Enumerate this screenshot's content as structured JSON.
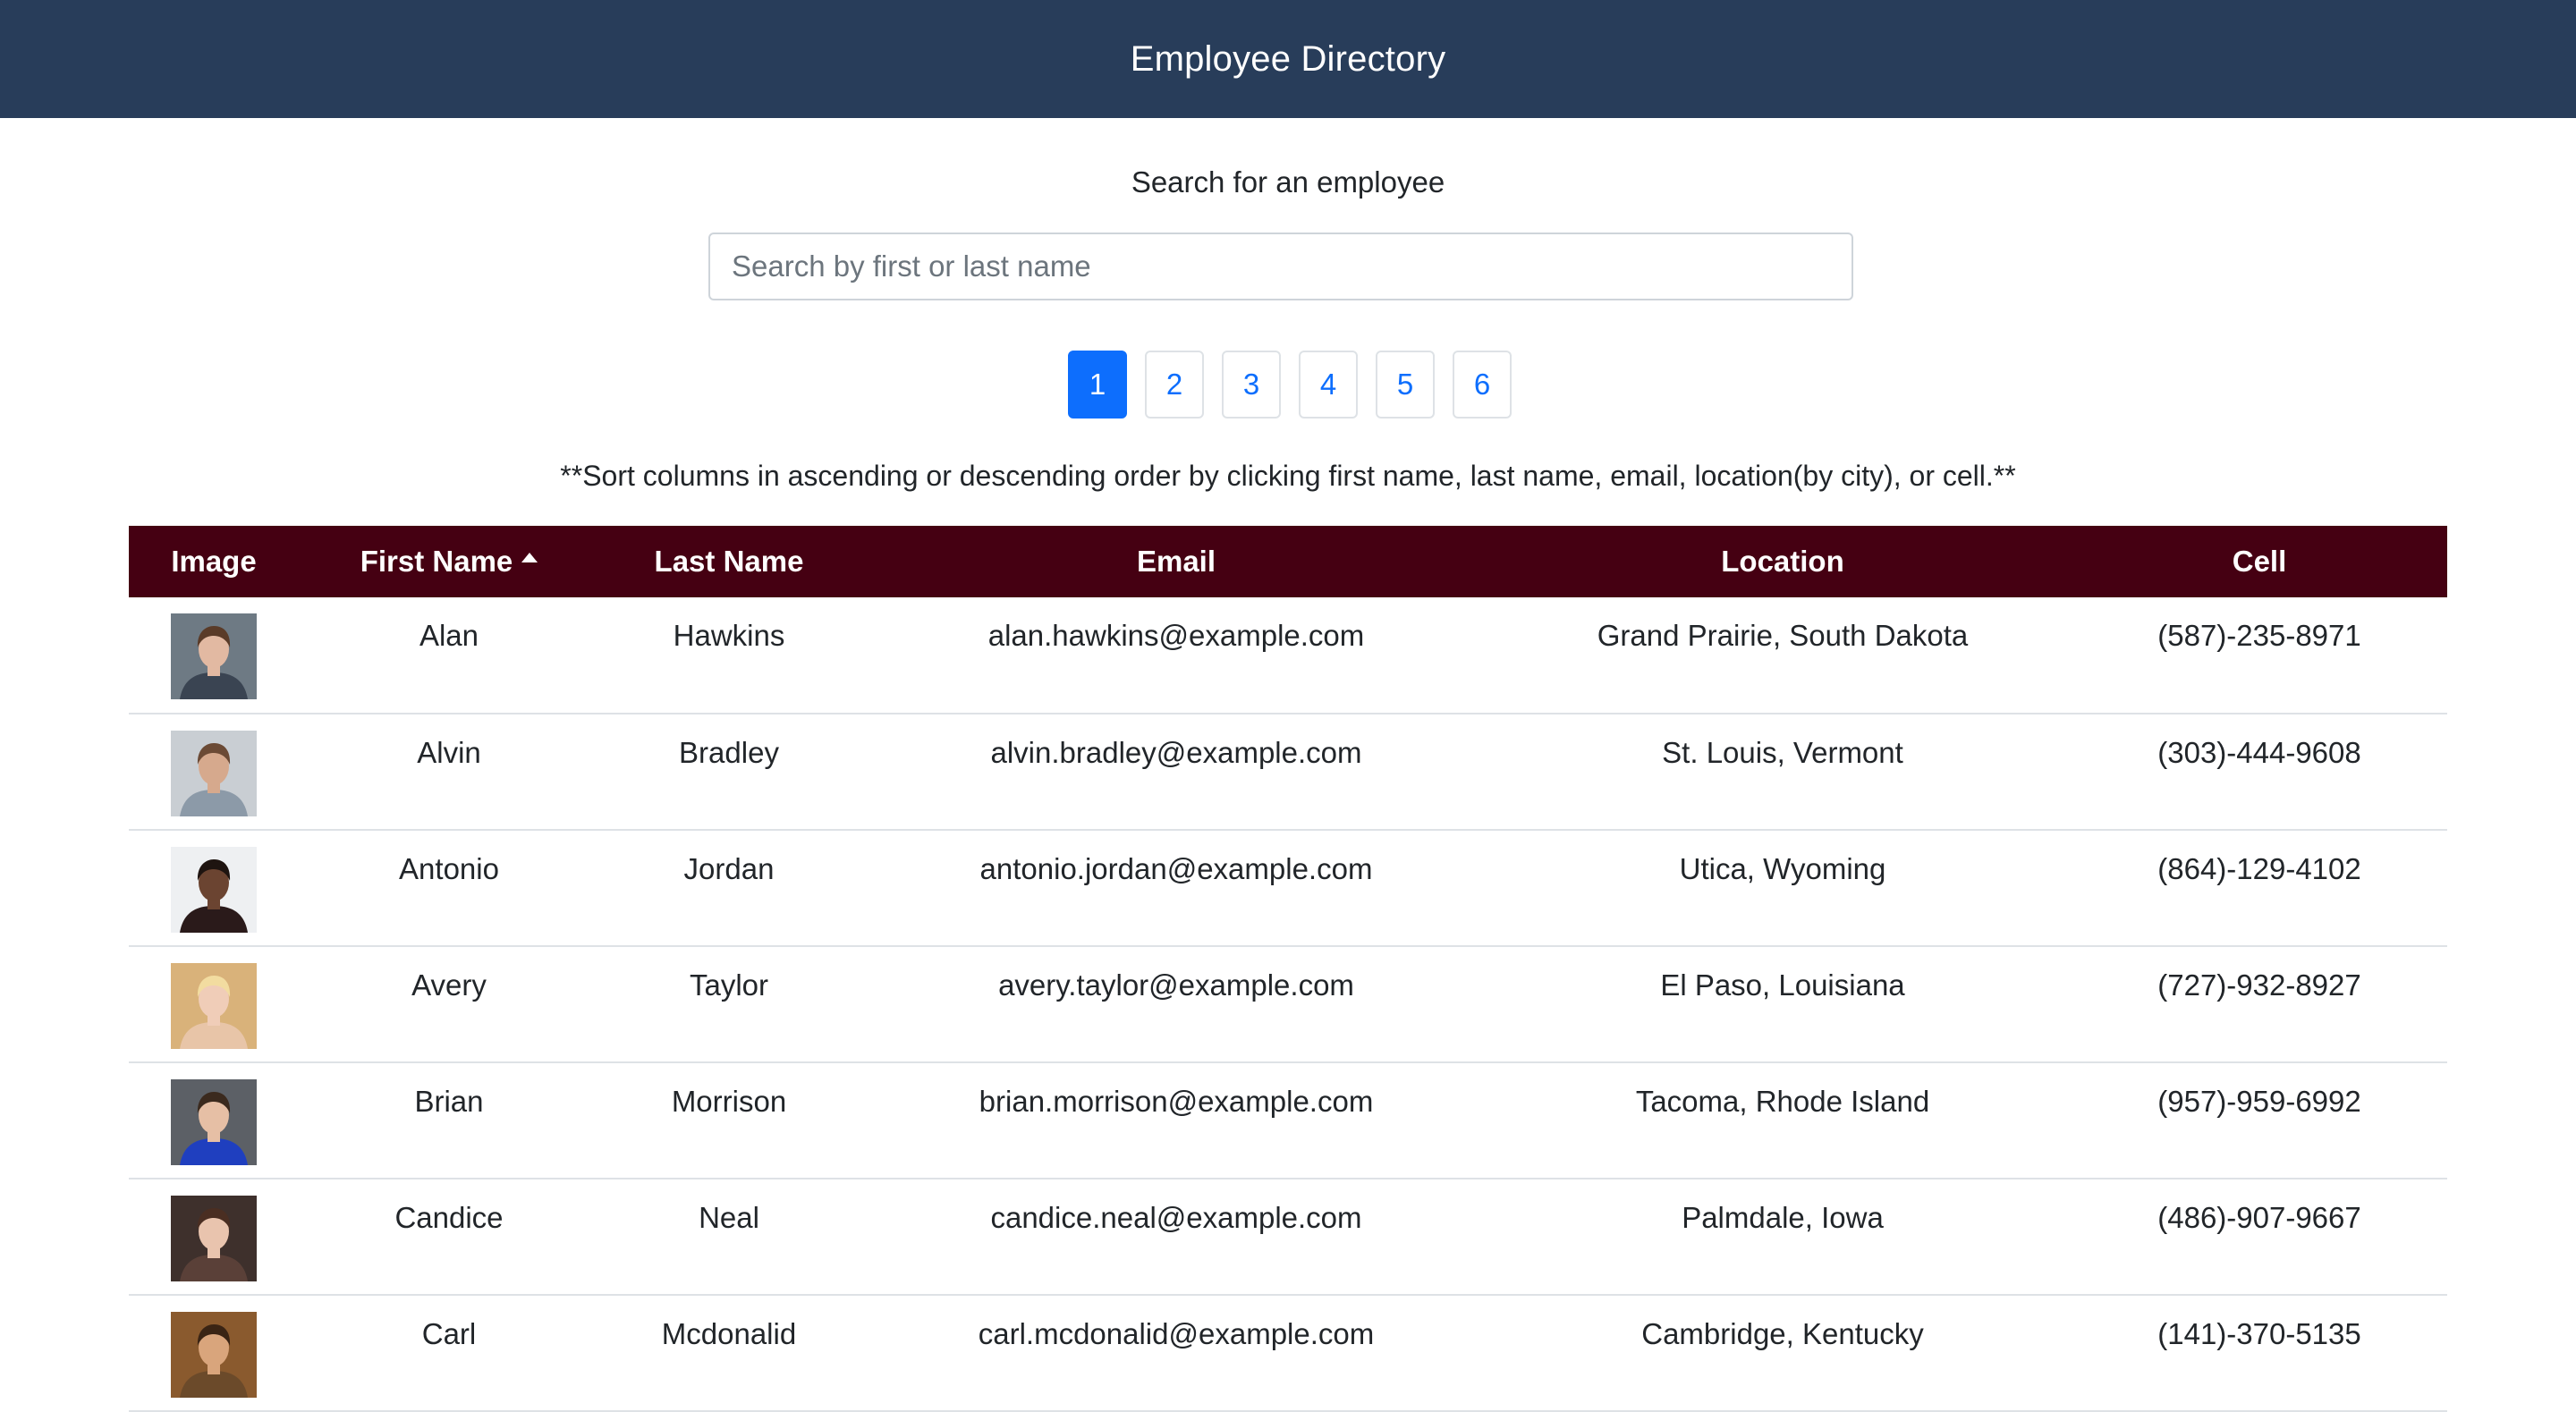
{
  "navbar": {
    "title": "Employee Directory"
  },
  "search": {
    "label": "Search for an employee",
    "placeholder": "Search by first or last name",
    "value": ""
  },
  "pagination": {
    "pages": [
      "1",
      "2",
      "3",
      "4",
      "5",
      "6"
    ],
    "active": "1"
  },
  "sort_note": "**Sort columns in ascending or descending order by clicking first name, last name, email, location(by city), or cell.**",
  "table": {
    "headers": {
      "image": "Image",
      "first_name": "First Name",
      "last_name": "Last Name",
      "email": "Email",
      "location": "Location",
      "cell": "Cell"
    },
    "sorted_column": "first_name",
    "sort_direction": "ascending",
    "rows": [
      {
        "first": "Alan",
        "last": "Hawkins",
        "email": "alan.hawkins@example.com",
        "location": "Grand Prairie, South Dakota",
        "cell": "(587)-235-8971",
        "photo": {
          "bg": "#6e7a84",
          "skin": "#e2b9a2",
          "hair": "#5a3b28",
          "shirt": "#3a4452"
        }
      },
      {
        "first": "Alvin",
        "last": "Bradley",
        "email": "alvin.bradley@example.com",
        "location": "St. Louis, Vermont",
        "cell": "(303)-444-9608",
        "photo": {
          "bg": "#c9ced3",
          "skin": "#d6a98d",
          "hair": "#6b4a35",
          "shirt": "#8c9aa8"
        }
      },
      {
        "first": "Antonio",
        "last": "Jordan",
        "email": "antonio.jordan@example.com",
        "location": "Utica, Wyoming",
        "cell": "(864)-129-4102",
        "photo": {
          "bg": "#eef0f2",
          "skin": "#6b4431",
          "hair": "#1e1410",
          "shirt": "#2a1a1a"
        }
      },
      {
        "first": "Avery",
        "last": "Taylor",
        "email": "avery.taylor@example.com",
        "location": "El Paso, Louisiana",
        "cell": "(727)-932-8927",
        "photo": {
          "bg": "#d9b27a",
          "skin": "#f0cdb8",
          "hair": "#f2dca0",
          "shirt": "#e8c5a8"
        }
      },
      {
        "first": "Brian",
        "last": "Morrison",
        "email": "brian.morrison@example.com",
        "location": "Tacoma, Rhode Island",
        "cell": "(957)-959-6992",
        "photo": {
          "bg": "#5c6066",
          "skin": "#e6bfa5",
          "hair": "#3b2a1e",
          "shirt": "#1f3fbf"
        }
      },
      {
        "first": "Candice",
        "last": "Neal",
        "email": "candice.neal@example.com",
        "location": "Palmdale, Iowa",
        "cell": "(486)-907-9667",
        "photo": {
          "bg": "#3e302c",
          "skin": "#e9c4ae",
          "hair": "#4a2e22",
          "shirt": "#5a4038"
        }
      },
      {
        "first": "Carl",
        "last": "Mcdonalid",
        "email": "carl.mcdonalid@example.com",
        "location": "Cambridge, Kentucky",
        "cell": "(141)-370-5135",
        "photo": {
          "bg": "#8a5a2e",
          "skin": "#d9a57c",
          "hair": "#3a2414",
          "shirt": "#6b4a2a"
        }
      }
    ]
  }
}
